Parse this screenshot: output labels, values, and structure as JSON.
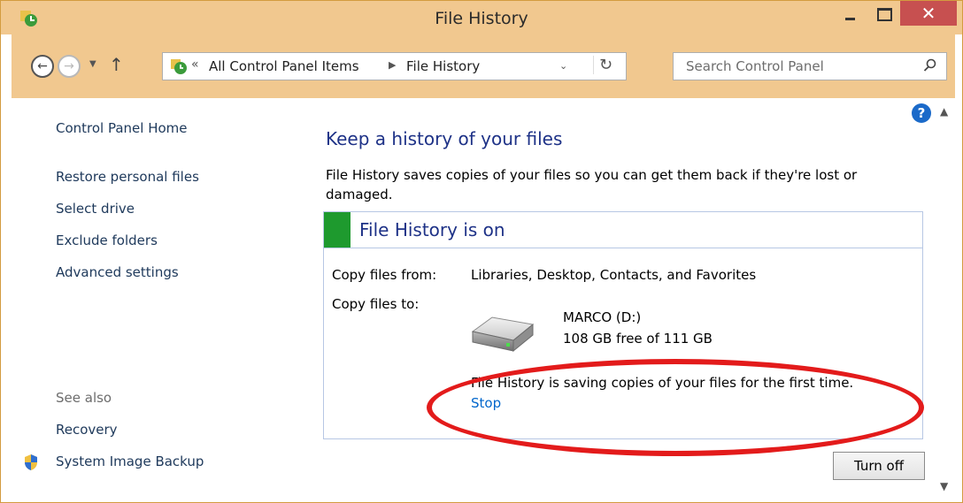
{
  "window": {
    "title": "File History",
    "close_glyph": "✕"
  },
  "nav": {
    "address_sep": "«",
    "crumb1": "All Control Panel Items",
    "crumb_arrow": "▶",
    "crumb2": "File History",
    "dropdown_glyph": "⌄",
    "refresh_glyph": "↻",
    "search_placeholder": "Search Control Panel"
  },
  "sidebar": {
    "home": "Control Panel Home",
    "items": [
      "Restore personal files",
      "Select drive",
      "Exclude folders",
      "Advanced settings"
    ],
    "see_also": "See also",
    "see_also_items": [
      "Recovery",
      "System Image Backup"
    ]
  },
  "main": {
    "title": "Keep a history of your files",
    "description": "File History saves copies of your files so you can get them back if they're lost or damaged.",
    "status": {
      "title": "File History is on",
      "color": "#1e9a2e"
    },
    "copy_from_label": "Copy files from:",
    "copy_from_value": "Libraries, Desktop, Contacts, and Favorites",
    "copy_to_label": "Copy files to:",
    "drive_name": "MARCO (D:)",
    "drive_space": "108 GB free of 111 GB",
    "saving_message": "File History is saving copies of your files for the first time.",
    "stop_link": "Stop",
    "turn_off_button": "Turn off"
  },
  "annotation": {
    "color": "#e31b1b"
  },
  "icons": [
    "app-icon",
    "back-icon",
    "forward-icon",
    "up-icon",
    "control-panel-icon",
    "refresh-icon",
    "search-icon",
    "help-icon",
    "drive-icon",
    "shield-icon"
  ]
}
